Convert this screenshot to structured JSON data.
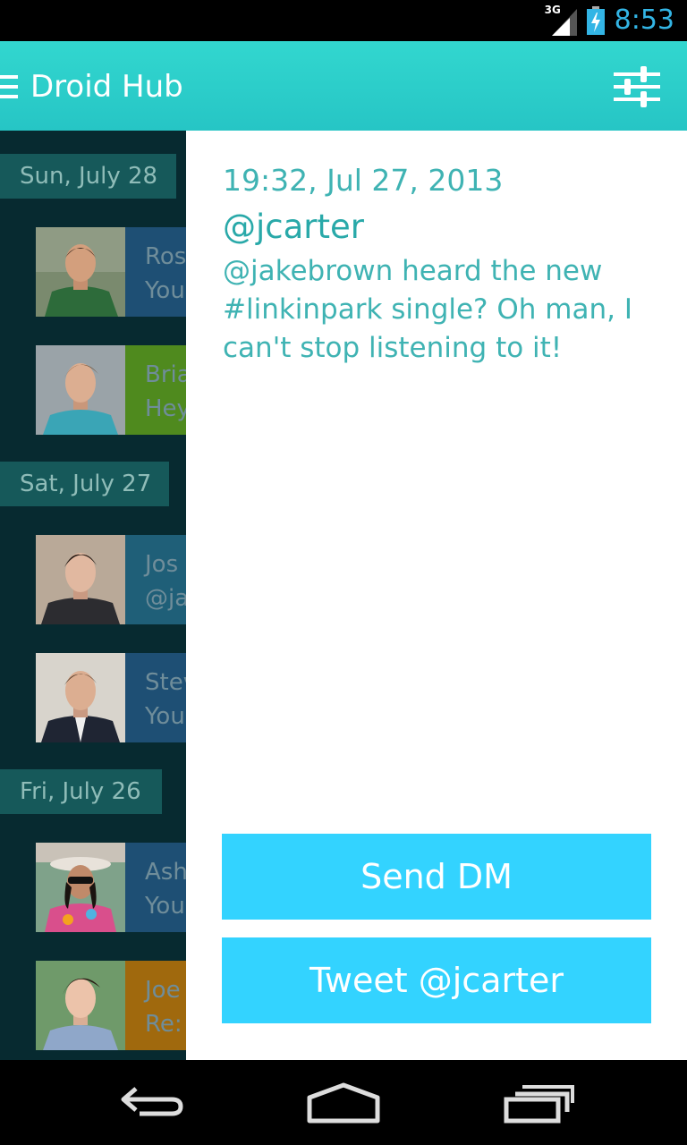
{
  "status_bar": {
    "network": "3G",
    "time": "8:53"
  },
  "app_bar": {
    "title": "Droid Hub",
    "icons": [
      "menu-icon",
      "filter-sliders-icon"
    ]
  },
  "feed": {
    "groups": [
      {
        "date": "Sun, July 28",
        "items": [
          {
            "name": "Ros",
            "preview": "You",
            "color": "#1e4f74"
          },
          {
            "name": "Bria",
            "preview": "Hey",
            "color": "#4f8a1e"
          }
        ]
      },
      {
        "date": "Sat, July 27",
        "items": [
          {
            "name": "Jos",
            "preview": "@ja",
            "color": "#1f5f78"
          },
          {
            "name": "Stev",
            "preview": "You",
            "color": "#1e4f74"
          }
        ]
      },
      {
        "date": "Fri, July 26",
        "items": [
          {
            "name": "Ash",
            "preview": "You",
            "color": "#1e4f74"
          },
          {
            "name": "Joe",
            "preview": "Re:",
            "color": "#a0690d"
          }
        ]
      }
    ]
  },
  "detail": {
    "timestamp": "19:32, Jul 27, 2013",
    "username": "@jcarter",
    "text": "@jakebrown heard the new #linkinpark single? Oh man, I can't stop listening to it!",
    "send_dm_label": "Send DM",
    "tweet_label": "Tweet @jcarter"
  },
  "colors": {
    "accent": "#33d3ff",
    "app_bar": "#2ccfcb",
    "text_teal": "#3fb3b3"
  },
  "nav_bar": {
    "icons": [
      "back-icon",
      "home-icon",
      "recent-apps-icon"
    ]
  }
}
